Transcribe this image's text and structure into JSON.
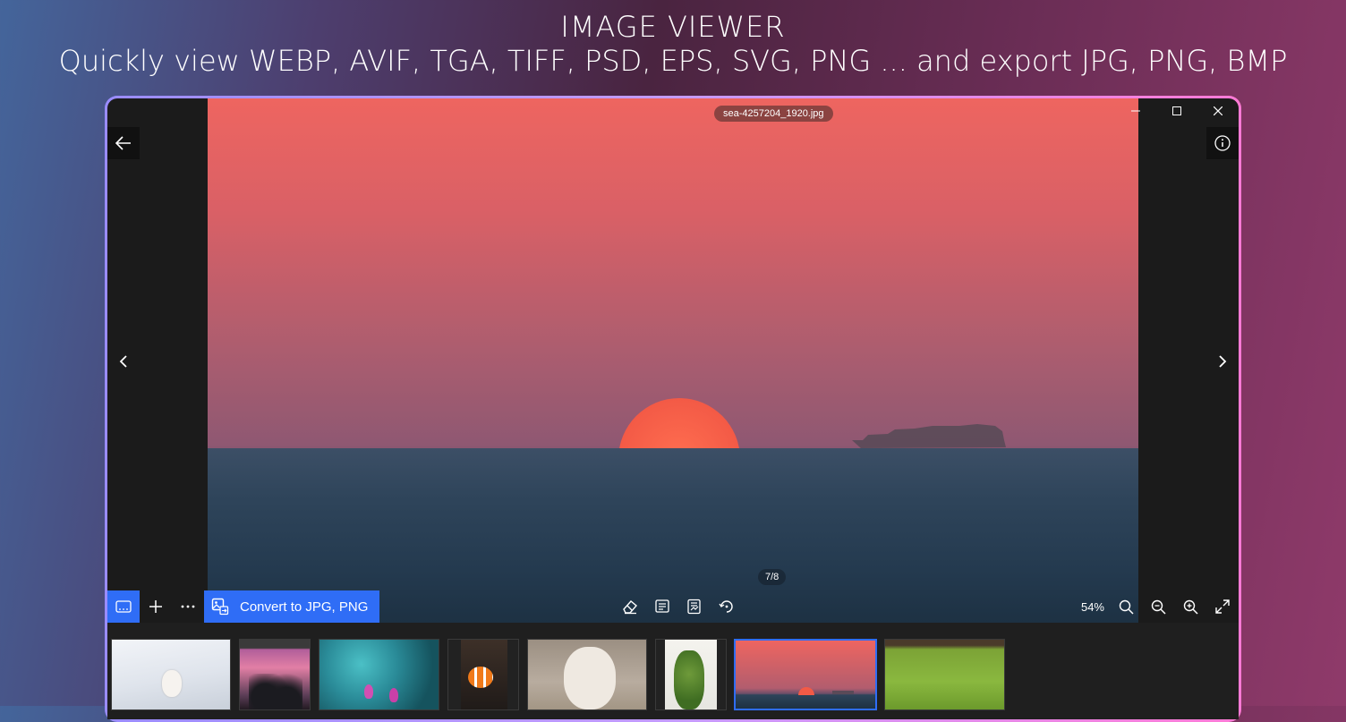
{
  "hero": {
    "title": "IMAGE VIEWER",
    "subtitle": "Quickly view WEBP, AVIF, TGA, TIFF, PSD, EPS, SVG, PNG ... and export JPG, PNG, BMP"
  },
  "viewer": {
    "filename": "sea-4257204_1920.jpg",
    "counter": "7/8",
    "zoom": "54%",
    "current_index": 7,
    "total": 8
  },
  "toolbar": {
    "convert_label": "Convert to JPG, PNG",
    "left_icons": [
      "filmstrip-icon",
      "plus-icon",
      "more-icon"
    ],
    "center_icons": [
      "eraser-icon",
      "crop-icon",
      "edit-icon",
      "rotate-icon"
    ],
    "right_icons": [
      "search-icon",
      "zoom-out-icon",
      "zoom-in-icon",
      "fullscreen-icon"
    ]
  },
  "window_controls": [
    "minimize-icon",
    "maximize-icon",
    "close-icon"
  ],
  "thumbnails": [
    {
      "name": "white-cat-snow"
    },
    {
      "name": "pink-sky-trees"
    },
    {
      "name": "lotus-pond"
    },
    {
      "name": "clownfish"
    },
    {
      "name": "white-dog"
    },
    {
      "name": "bananas"
    },
    {
      "name": "sea-sunset",
      "selected": true
    },
    {
      "name": "green-field"
    }
  ],
  "colors": {
    "accent": "#2f6df6",
    "window_bg": "#1b1b1b"
  }
}
